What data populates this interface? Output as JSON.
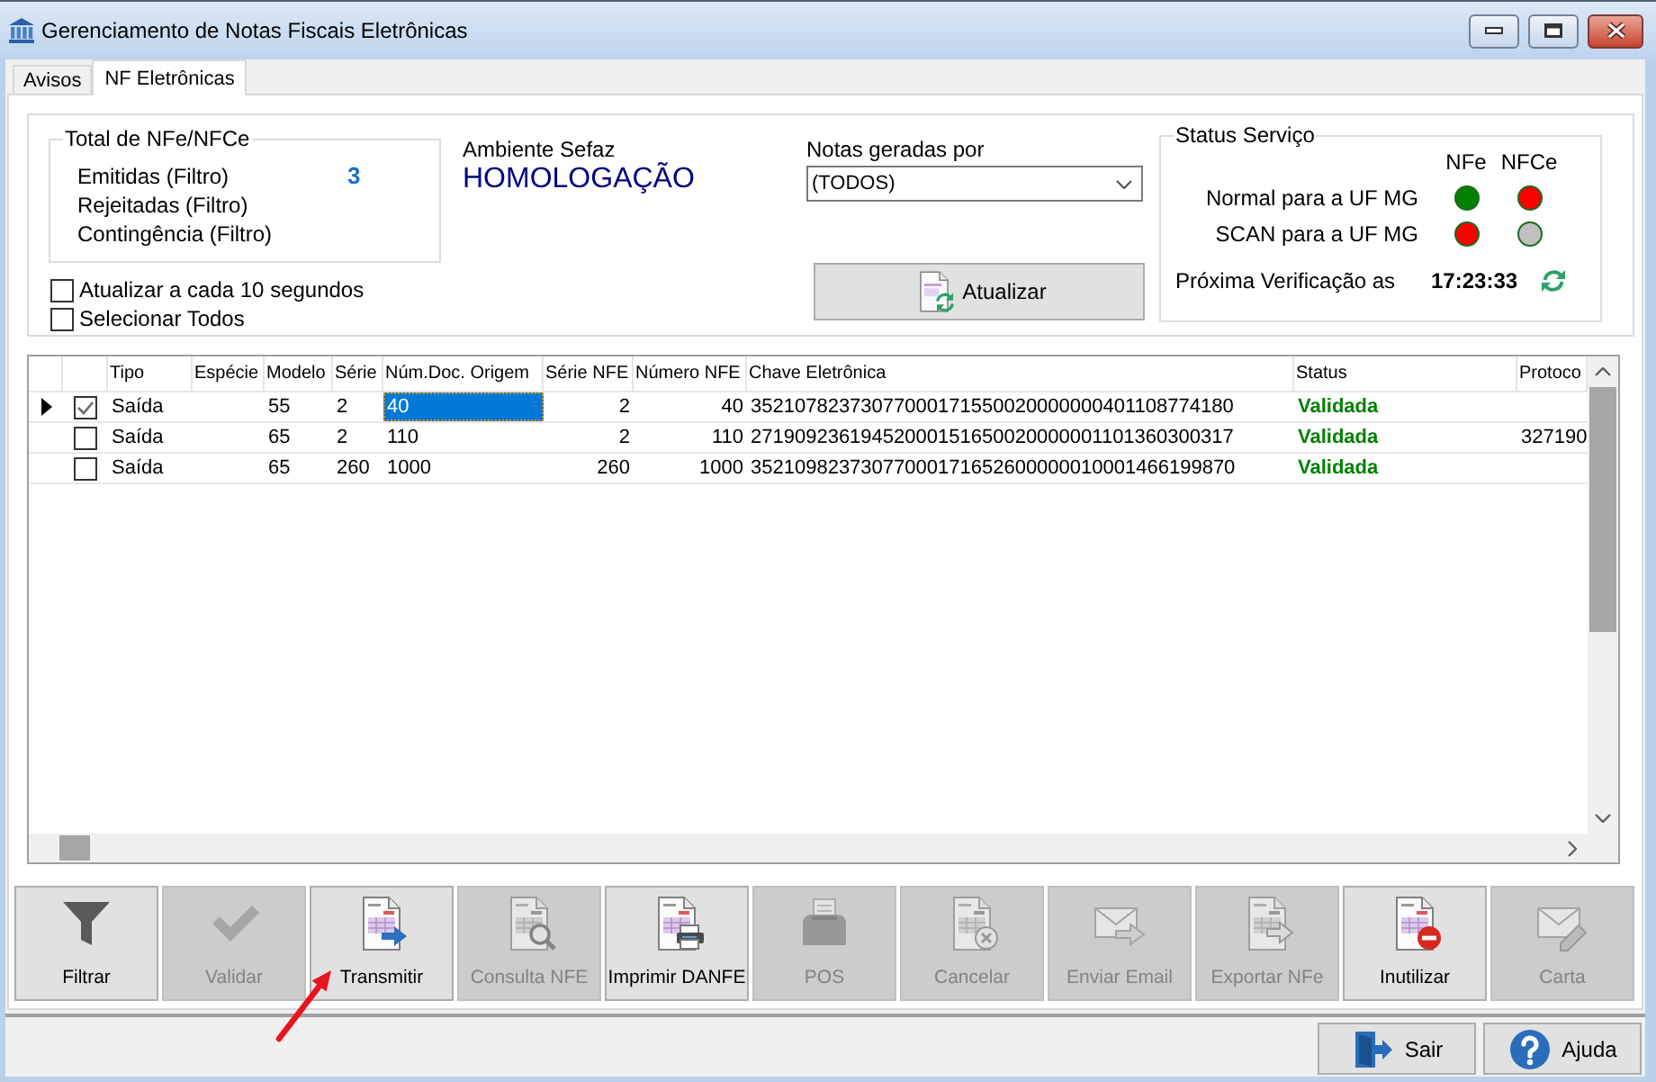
{
  "window": {
    "title": "Gerenciamento de Notas Fiscais Eletrônicas"
  },
  "tabs": [
    {
      "label": "Avisos",
      "selected": false
    },
    {
      "label": "NF Eletrônicas",
      "selected": true
    }
  ],
  "totals": {
    "title": "Total de NFe/NFCe",
    "rows": [
      {
        "label": "Emitidas (Filtro)",
        "value": "3"
      },
      {
        "label": "Rejeitadas (Filtro)"
      },
      {
        "label": "Contingência (Filtro)"
      }
    ]
  },
  "options": [
    {
      "label": "Atualizar a cada 10 segundos",
      "checked": false
    },
    {
      "label": "Selecionar Todos",
      "checked": false
    }
  ],
  "ambiente": {
    "label": "Ambiente Sefaz",
    "value": "HOMOLOGAÇÃO"
  },
  "notas_geradas_por": {
    "label": "Notas geradas por",
    "value": "(TODOS)"
  },
  "refresh_button": {
    "label": "Atualizar"
  },
  "status_servico": {
    "title": "Status Serviço",
    "columns": [
      "NFe",
      "NFCe"
    ],
    "rows": [
      {
        "label": "Normal para a UF MG",
        "indicators": [
          {
            "color": "#008000"
          },
          {
            "color": "#ff0000"
          }
        ]
      },
      {
        "label": "SCAN para a UF MG",
        "indicators": [
          {
            "color": "#ff0000"
          },
          {
            "color": "#c0c0c0"
          }
        ]
      }
    ],
    "next_check_label": "Próxima Verificação as",
    "next_check_time": "17:23:33"
  },
  "table": {
    "columns": [
      {
        "label": "Tipo",
        "current": false
      },
      {
        "label": "Espécie",
        "current": false
      },
      {
        "label": "Modelo",
        "current": false
      },
      {
        "label": "Série",
        "current": false
      },
      {
        "label": "Núm.Doc. Origem",
        "current": true
      },
      {
        "label": "Série NFE",
        "current": false
      },
      {
        "label": "Número NFE",
        "current": false
      },
      {
        "label": "Chave Eletrônica",
        "current": false
      },
      {
        "label": "Status",
        "current": false
      },
      {
        "label": "Protoco",
        "current": false
      }
    ],
    "rows": [
      {
        "selected": true,
        "checked": true,
        "cells": [
          "Saída",
          null,
          "55",
          "2",
          "40",
          "2",
          "40",
          "35210782373077000171550020000000401108774180",
          "Validada",
          null
        ]
      },
      {
        "selected": false,
        "checked": false,
        "cells": [
          "Saída",
          null,
          "65",
          "2",
          "110",
          "2",
          "110",
          "27190923619452000151650020000001101360300317",
          "Validada",
          "327190"
        ]
      },
      {
        "selected": false,
        "checked": false,
        "cells": [
          "Saída",
          null,
          "65",
          "260",
          "1000",
          "260",
          "1000",
          "35210982373077000171652600000010001466199870",
          "Validada",
          null
        ]
      }
    ]
  },
  "toolbar": [
    {
      "label": "Filtrar",
      "disabled": false
    },
    {
      "label": "Validar",
      "disabled": true
    },
    {
      "label": "Transmitir",
      "disabled": false
    },
    {
      "label": "Consulta NFE",
      "disabled": true
    },
    {
      "label": "Imprimir DANFE",
      "disabled": false
    },
    {
      "label": "POS",
      "disabled": true
    },
    {
      "label": "Cancelar",
      "disabled": true
    },
    {
      "label": "Enviar Email",
      "disabled": true
    },
    {
      "label": "Exportar NFe",
      "disabled": true
    },
    {
      "label": "Inutilizar",
      "disabled": false
    },
    {
      "label": "Carta",
      "disabled": true
    }
  ],
  "footer_buttons": [
    {
      "label": "Sair"
    },
    {
      "label": "Ajuda"
    }
  ]
}
